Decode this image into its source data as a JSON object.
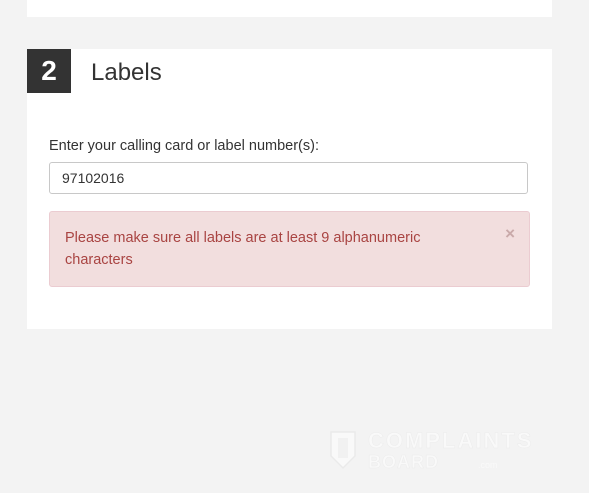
{
  "section": {
    "step_number": "2",
    "title": "Labels"
  },
  "form": {
    "label": "Enter your calling card or label number(s):",
    "input_value": "97102016"
  },
  "alert": {
    "message": "Please make sure all labels are at least 9 alphanumeric characters",
    "close_symbol": "×",
    "background_color": "#f2dede",
    "text_color": "#a94442"
  },
  "watermark": {
    "line1": "COMPLAINTS",
    "line2": "BOARD",
    "line3": ".com"
  }
}
